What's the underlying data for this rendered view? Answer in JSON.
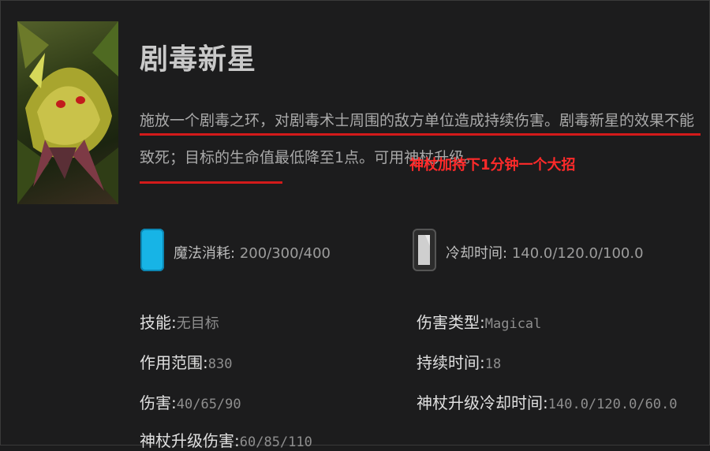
{
  "ability": {
    "name": "剧毒新星",
    "description": "施放一个剧毒之环，对剧毒术士周围的敌方单位造成持续伤害。剧毒新星的效果不能致死；目标的生命值最低降至1点。可用神杖升级。",
    "portrait_icon": "venomancer-portrait"
  },
  "annotation": "神杖加持下1分钟一个大招",
  "stats": {
    "mana": {
      "icon": "mana-cost-icon",
      "label": "魔法消耗:",
      "value": "200/300/400"
    },
    "cooldown": {
      "icon": "cooldown-icon",
      "label": "冷却时间:",
      "value": "140.0/120.0/100.0"
    }
  },
  "details": {
    "left": [
      {
        "key": "技能:",
        "value": "无目标"
      },
      {
        "key": "作用范围:",
        "value": "830"
      },
      {
        "key": "伤害:",
        "value": "40/65/90"
      },
      {
        "key": "神杖升级伤害:",
        "value": "60/85/110"
      }
    ],
    "right": [
      {
        "key": "伤害类型:",
        "value": "Magical"
      },
      {
        "key": "持续时间:",
        "value": "18"
      },
      {
        "key": "神杖升级冷却时间:",
        "value": "140.0/120.0/60.0"
      }
    ]
  },
  "colors": {
    "background": "#1c1c1d",
    "annotation": "#ff2a2a",
    "underline": "#d31a1a",
    "mana": "#17b4e6"
  }
}
